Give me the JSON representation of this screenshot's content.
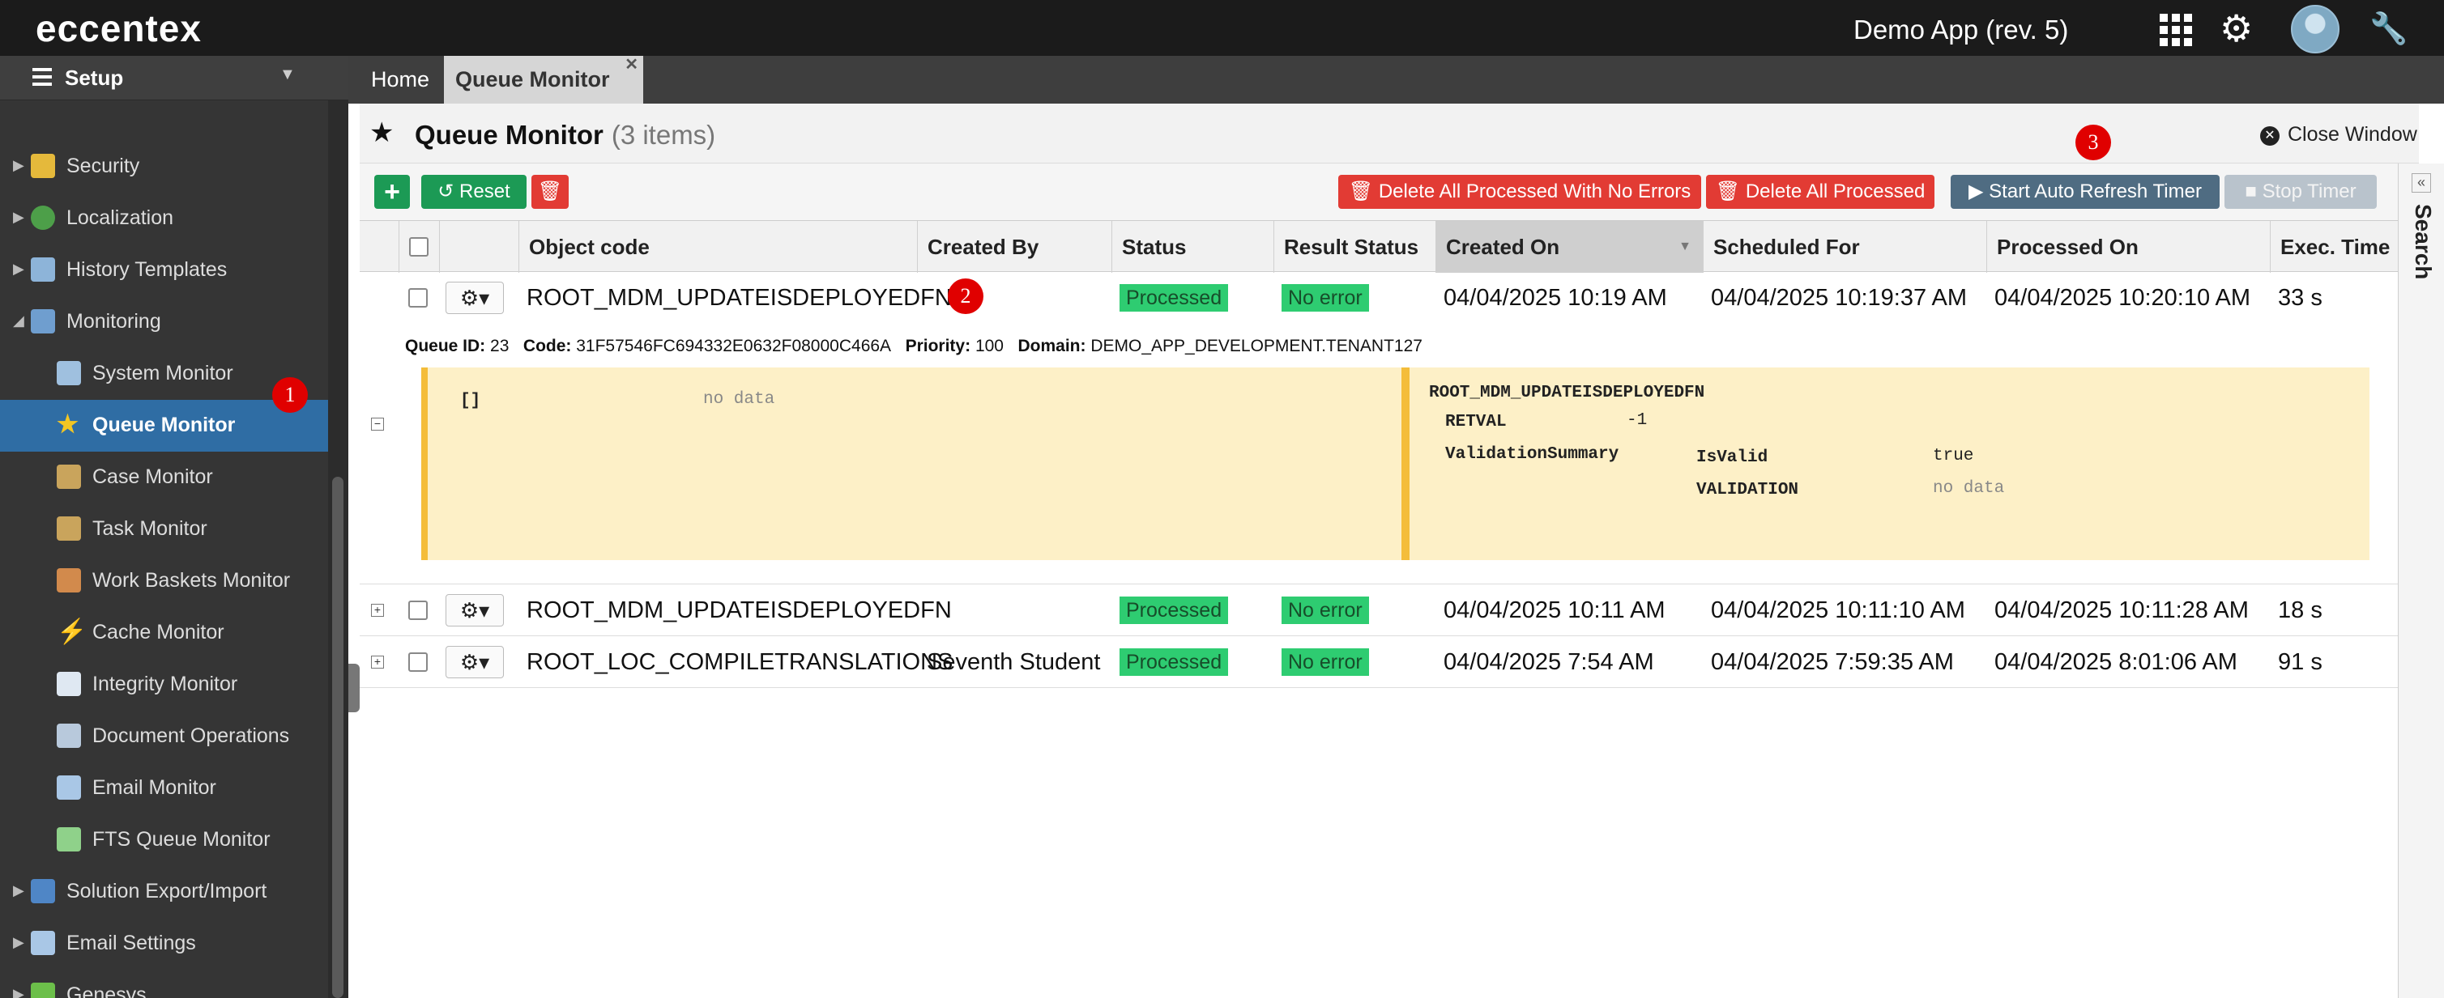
{
  "topbar": {
    "logo": "eccentex",
    "app_name": "Demo App (rev. 5)",
    "icons": [
      "apps-grid-icon",
      "gear-icon",
      "avatar",
      "wrench-icon"
    ]
  },
  "sidebar": {
    "title": "Setup",
    "items": [
      {
        "label": "Security",
        "icon": "lock-icon",
        "level": "top"
      },
      {
        "label": "Localization",
        "icon": "globe-icon",
        "level": "top"
      },
      {
        "label": "History Templates",
        "icon": "history-icon",
        "level": "top"
      },
      {
        "label": "Monitoring",
        "icon": "monitor-icon",
        "level": "top"
      },
      {
        "label": "System Monitor",
        "icon": "grid-icon",
        "level": "sub"
      },
      {
        "label": "Queue Monitor",
        "icon": "star-icon",
        "level": "sub",
        "active": true
      },
      {
        "label": "Case Monitor",
        "icon": "case-icon",
        "level": "sub"
      },
      {
        "label": "Task Monitor",
        "icon": "task-icon",
        "level": "sub"
      },
      {
        "label": "Work Baskets Monitor",
        "icon": "basket-icon",
        "level": "sub"
      },
      {
        "label": "Cache Monitor",
        "icon": "lightning-icon",
        "level": "sub"
      },
      {
        "label": "Integrity Monitor",
        "icon": "integrity-icon",
        "level": "sub"
      },
      {
        "label": "Document Operations",
        "icon": "document-icon",
        "level": "sub"
      },
      {
        "label": "Email Monitor",
        "icon": "email-icon",
        "level": "sub"
      },
      {
        "label": "FTS Queue Monitor",
        "icon": "fts-icon",
        "level": "sub"
      },
      {
        "label": "Solution Export/Import",
        "icon": "disk-icon",
        "level": "top"
      },
      {
        "label": "Email Settings",
        "icon": "email-settings-icon",
        "level": "top"
      },
      {
        "label": "Genesys",
        "icon": "puzzle-icon",
        "level": "top"
      }
    ]
  },
  "badges": [
    "1",
    "2",
    "3"
  ],
  "tabs": [
    {
      "label": "Home"
    },
    {
      "label": "Queue Monitor",
      "active": true
    }
  ],
  "header": {
    "title": "Queue Monitor",
    "count": "(3 items)",
    "close_label": "Close Window"
  },
  "toolbar": {
    "reset_label": "Reset",
    "delete_no_errors_label": "Delete All Processed With No Errors",
    "delete_all_label": "Delete All Processed",
    "start_timer_label": "Start Auto Refresh Timer",
    "stop_timer_label": "Stop Timer"
  },
  "table": {
    "columns": [
      "Object code",
      "Created By",
      "Status",
      "Result Status",
      "Created On",
      "Scheduled For",
      "Processed On",
      "Exec. Time"
    ],
    "rows": [
      {
        "object_code": "ROOT_MDM_UPDATEISDEPLOYEDFN",
        "created_by": "",
        "status": "Processed",
        "result": "No error",
        "created_on": "04/04/2025 10:19 AM",
        "scheduled_for": "04/04/2025 10:19:37 AM",
        "processed_on": "04/04/2025 10:20:10 AM",
        "exec_time": "33 s"
      },
      {
        "object_code": "ROOT_MDM_UPDATEISDEPLOYEDFN",
        "created_by": "",
        "status": "Processed",
        "result": "No error",
        "created_on": "04/04/2025 10:11 AM",
        "scheduled_for": "04/04/2025 10:11:10 AM",
        "processed_on": "04/04/2025 10:11:28 AM",
        "exec_time": "18 s"
      },
      {
        "object_code": "ROOT_LOC_COMPILETRANSLATIONS",
        "created_by": "Seventh Student",
        "status": "Processed",
        "result": "No error",
        "created_on": "04/04/2025 7:54 AM",
        "scheduled_for": "04/04/2025 7:59:35 AM",
        "processed_on": "04/04/2025 8:01:06 AM",
        "exec_time": "91 s"
      }
    ]
  },
  "detail": {
    "queue_id_label": "Queue ID:",
    "queue_id": "23",
    "code_label": "Code:",
    "code": "31F57546FC694332E0632F08000C466A",
    "priority_label": "Priority:",
    "priority": "100",
    "domain_label": "Domain:",
    "domain": "DEMO_APP_DEVELOPMENT.TENANT127",
    "left_key": "[]",
    "left_value": "no data",
    "fn_name": "ROOT_MDM_UPDATEISDEPLOYEDFN",
    "retval_label": "RETVAL",
    "retval": "-1",
    "summary_label": "ValidationSummary",
    "isvalid_label": "IsValid",
    "isvalid": "true",
    "validation_label": "VALIDATION",
    "validation": "no data"
  },
  "right_panel": {
    "label": "Search"
  },
  "colors": {
    "topbar": "#1b1b1b",
    "sidebar": "#353535",
    "active_item": "#2f6da4",
    "green_button": "#1c9a55",
    "red_button": "#e23b34",
    "status_green": "#2ecc71",
    "detail_bg": "#fdf0c7",
    "detail_accent": "#f4bd3a",
    "badge_red": "#e00000"
  }
}
